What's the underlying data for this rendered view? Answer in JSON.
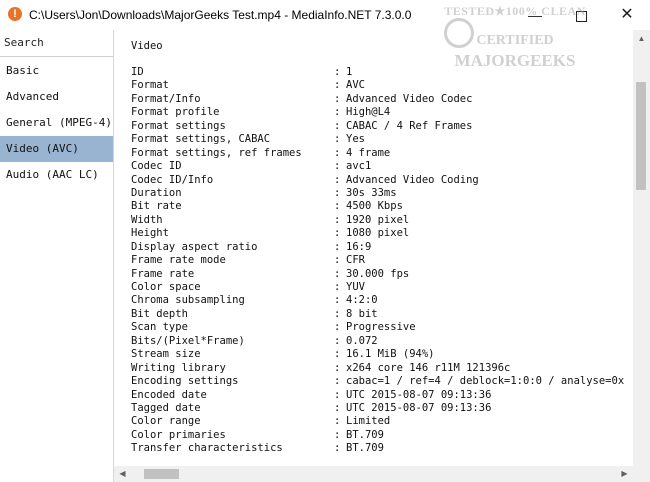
{
  "window": {
    "title": "C:\\Users\\Jon\\Downloads\\MajorGeeks Test.mp4 - MediaInfo.NET 7.3.0.0",
    "icon": "info-icon",
    "minimize_glyph": "—",
    "close_glyph": "✕"
  },
  "watermark": {
    "line1": "TESTED★100% CLEAN",
    "line2": "CERTIFIED",
    "line3": "MAJORGEEKS"
  },
  "sidebar": {
    "search_label": "Search",
    "items": [
      {
        "label": "Basic"
      },
      {
        "label": "Advanced"
      },
      {
        "label": "General (MPEG-4)"
      },
      {
        "label": "Video (AVC)"
      },
      {
        "label": "Audio (AAC LC)"
      }
    ],
    "selected_index": 3,
    "selected_color": "#99b4d1"
  },
  "content": {
    "section_title": "Video",
    "separator": ":",
    "rows": [
      {
        "label": "ID",
        "value": "1"
      },
      {
        "label": "Format",
        "value": "AVC"
      },
      {
        "label": "Format/Info",
        "value": "Advanced Video Codec"
      },
      {
        "label": "Format profile",
        "value": "High@L4"
      },
      {
        "label": "Format settings",
        "value": "CABAC / 4 Ref Frames"
      },
      {
        "label": "Format settings, CABAC",
        "value": "Yes"
      },
      {
        "label": "Format settings, ref frames",
        "value": "4 frame"
      },
      {
        "label": "Codec ID",
        "value": "avc1"
      },
      {
        "label": "Codec ID/Info",
        "value": "Advanced Video Coding"
      },
      {
        "label": "Duration",
        "value": "30s 33ms"
      },
      {
        "label": "Bit rate",
        "value": "4500 Kbps"
      },
      {
        "label": "Width",
        "value": "1920 pixel"
      },
      {
        "label": "Height",
        "value": "1080 pixel"
      },
      {
        "label": "Display aspect ratio",
        "value": "16:9"
      },
      {
        "label": "Frame rate mode",
        "value": "CFR"
      },
      {
        "label": "Frame rate",
        "value": "30.000 fps"
      },
      {
        "label": "Color space",
        "value": "YUV"
      },
      {
        "label": "Chroma subsampling",
        "value": "4:2:0"
      },
      {
        "label": "Bit depth",
        "value": "8 bit"
      },
      {
        "label": "Scan type",
        "value": "Progressive"
      },
      {
        "label": "Bits/(Pixel*Frame)",
        "value": "0.072"
      },
      {
        "label": "Stream size",
        "value": "16.1 MiB (94%)"
      },
      {
        "label": "Writing library",
        "value": "x264 core 146 r11M 121396c"
      },
      {
        "label": "Encoding settings",
        "value": "cabac=1 / ref=4 / deblock=1:0:0 / analyse=0x"
      },
      {
        "label": "Encoded date",
        "value": "UTC 2015-08-07 09:13:36"
      },
      {
        "label": "Tagged date",
        "value": "UTC 2015-08-07 09:13:36"
      },
      {
        "label": "Color range",
        "value": "Limited"
      },
      {
        "label": "Color primaries",
        "value": "BT.709"
      },
      {
        "label": "Transfer characteristics",
        "value": "BT.709"
      }
    ]
  }
}
